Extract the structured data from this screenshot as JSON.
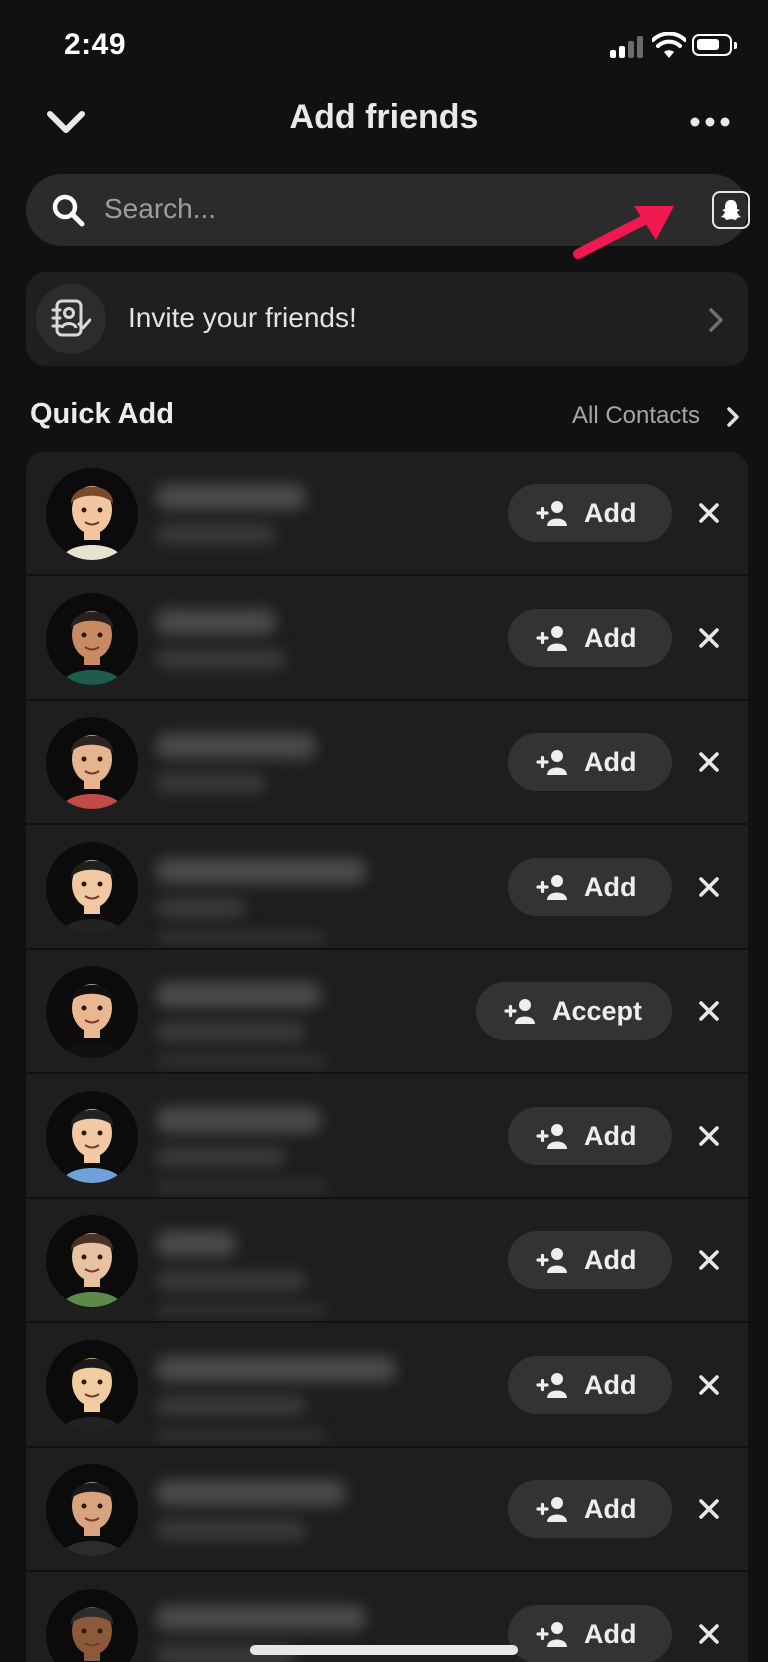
{
  "status_bar": {
    "time": "2:49"
  },
  "header": {
    "title": "Add friends"
  },
  "search": {
    "placeholder": "Search..."
  },
  "invite": {
    "label": "Invite your friends!"
  },
  "quick_add": {
    "title": "Quick Add",
    "all_contacts_label": "All Contacts",
    "rows": [
      {
        "action_label": "Add"
      },
      {
        "action_label": "Add"
      },
      {
        "action_label": "Add"
      },
      {
        "action_label": "Add"
      },
      {
        "action_label": "Accept"
      },
      {
        "action_label": "Add"
      },
      {
        "action_label": "Add"
      },
      {
        "action_label": "Add"
      },
      {
        "action_label": "Add"
      },
      {
        "action_label": "Add"
      }
    ]
  },
  "colors": {
    "background": "#111112",
    "card": "#1e1e1f",
    "button": "#333335",
    "annotation_arrow": "#f0184f"
  },
  "icons": [
    "chevron-down-icon",
    "more-icon",
    "search-icon",
    "snapcode-icon",
    "contacts-book-icon",
    "chevron-right-icon",
    "add-friend-icon",
    "close-icon"
  ]
}
